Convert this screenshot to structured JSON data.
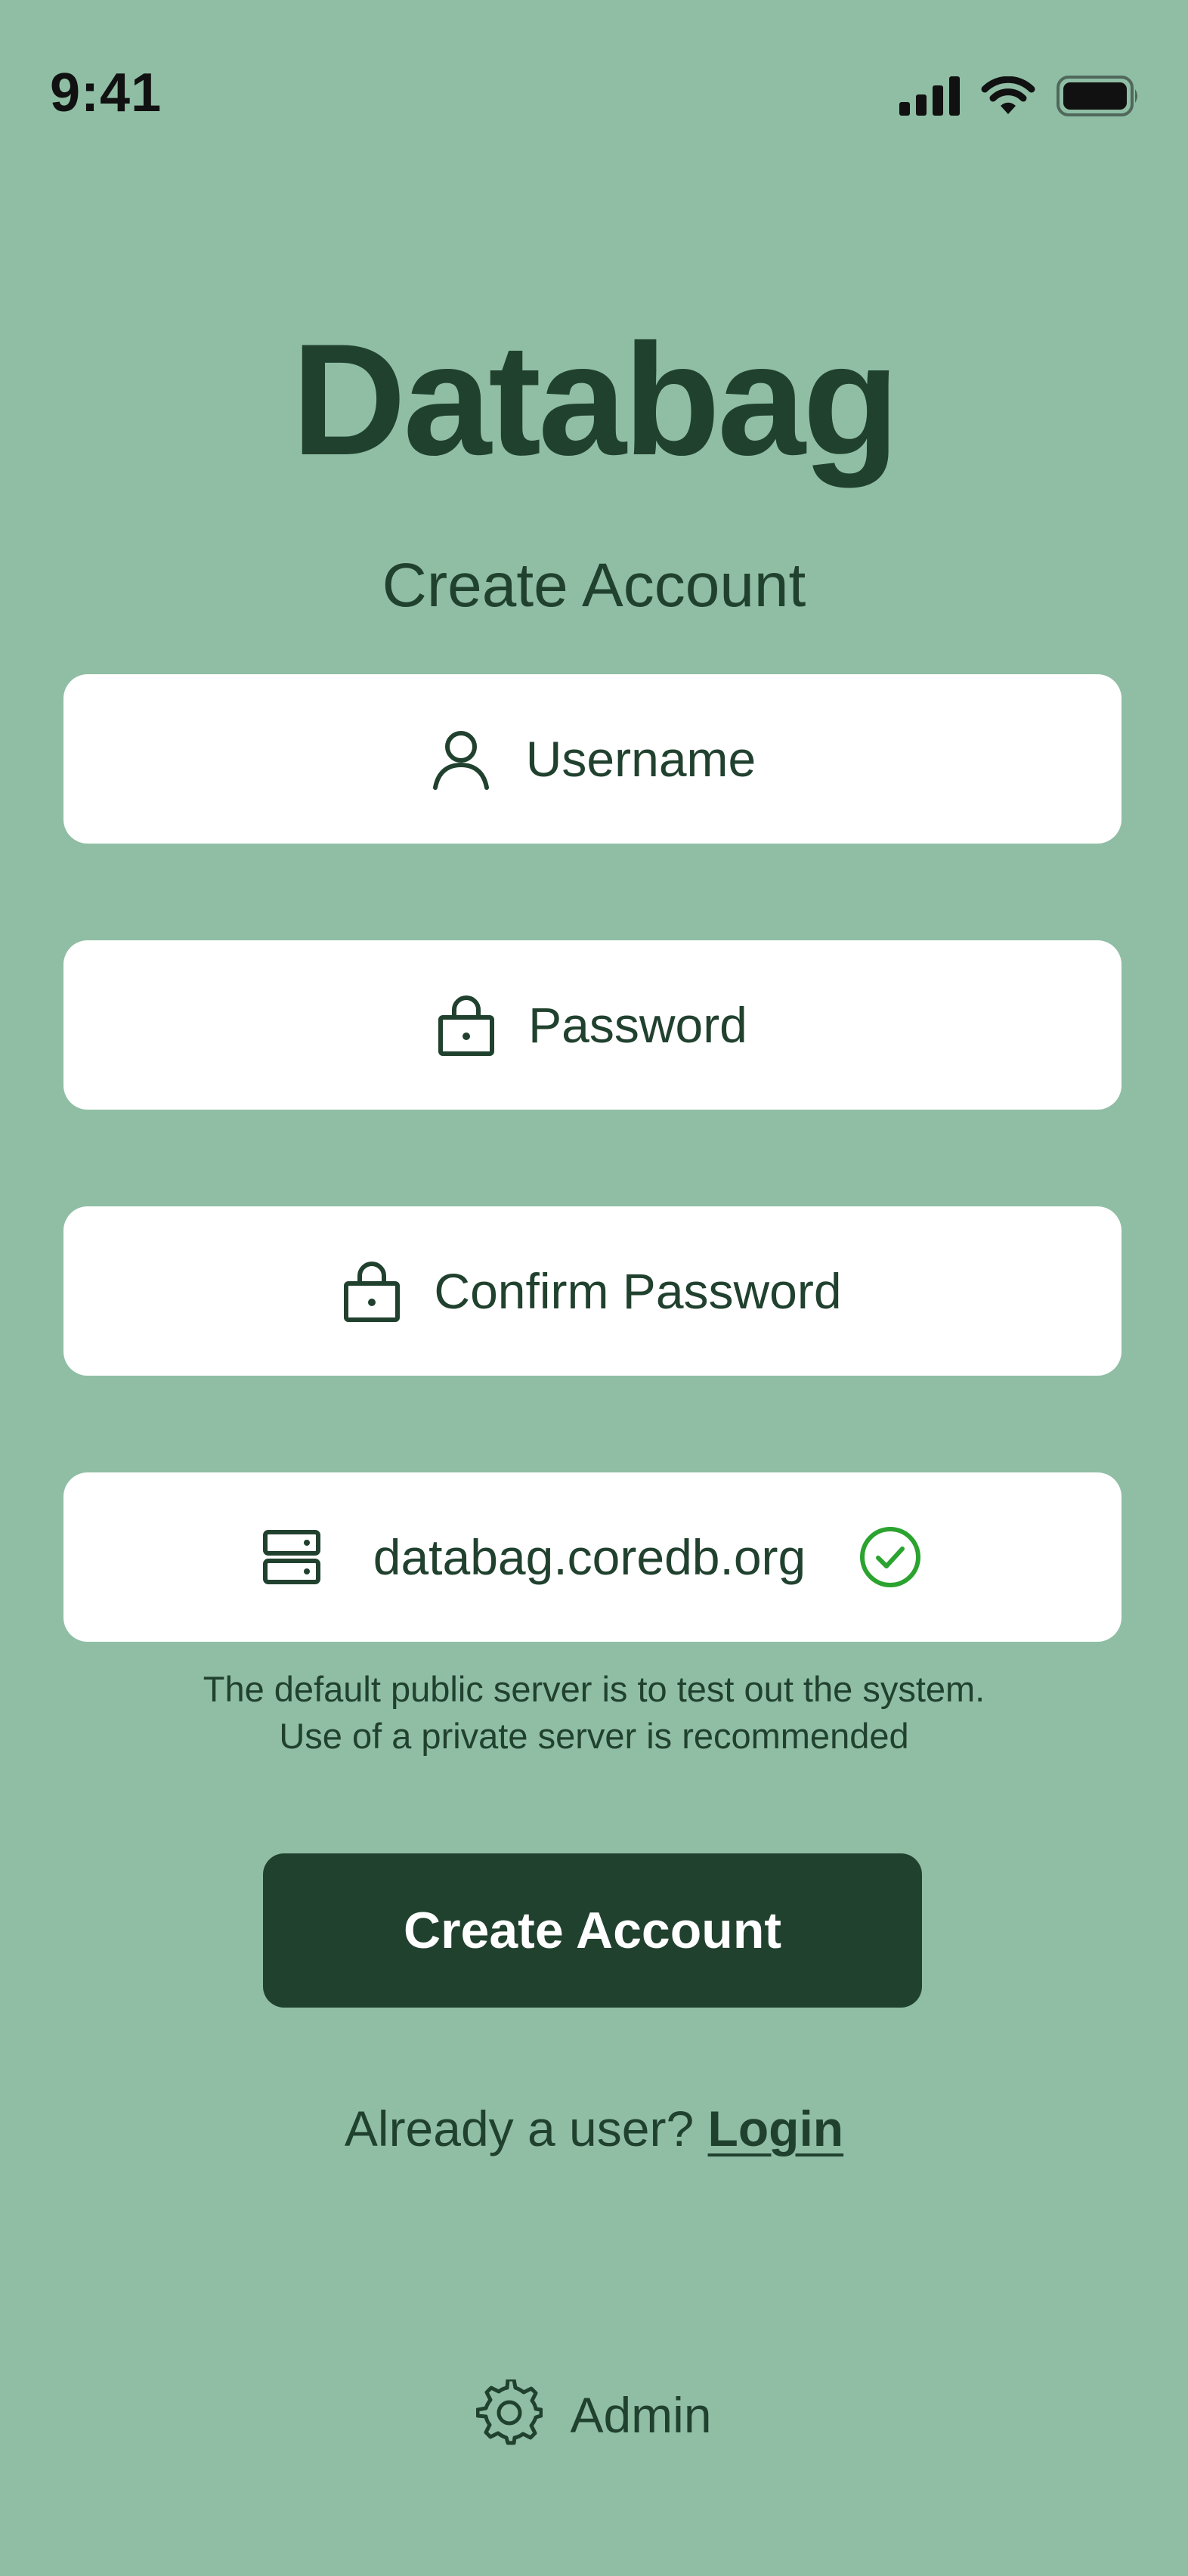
{
  "status_bar": {
    "time": "9:41"
  },
  "app": {
    "title": "Databag",
    "subtitle": "Create Account"
  },
  "form": {
    "username_placeholder": "Username",
    "password_placeholder": "Password",
    "confirm_password_placeholder": "Confirm Password",
    "server_value": "databag.coredb.org"
  },
  "notice": {
    "line1": "The default public server is to test out the system.",
    "line2": "Use of a private server is recommended"
  },
  "actions": {
    "create_account_label": "Create Account",
    "login_prompt": "Already a user? ",
    "login_link": "Login",
    "admin_label": "Admin"
  },
  "icons": {
    "username": "user-icon",
    "password": "lock-icon",
    "confirm_password": "lock-icon",
    "server": "server-icon",
    "server_status": "check-circle-icon",
    "admin": "gear-icon"
  },
  "colors": {
    "background": "#8FBEA4",
    "primary": "#21412F",
    "success": "#2BA32F",
    "field_bg": "#FFFFFF"
  }
}
